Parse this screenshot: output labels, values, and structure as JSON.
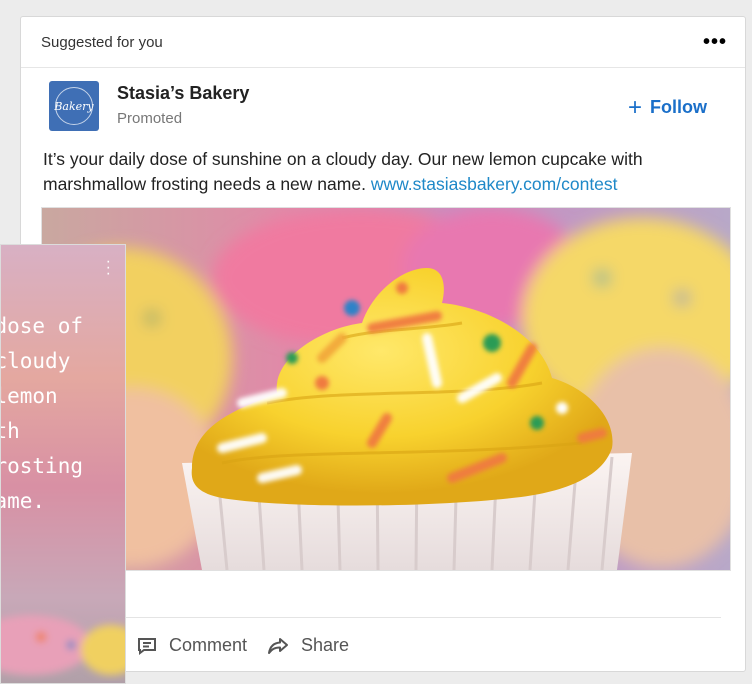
{
  "card": {
    "header_label": "Suggested for you",
    "more_label": "•••"
  },
  "author": {
    "name": "Stasia’s Bakery",
    "subtitle": "Promoted",
    "logo_text": "Bakery"
  },
  "follow": {
    "plus": "+",
    "label": "Follow"
  },
  "post": {
    "text": "It’s your daily dose of sunshine on a cloudy day. Our new lemon cupcake with marshmallow frosting needs a new name.",
    "link": "www.stasiasbakery.com/contest"
  },
  "actions": [
    {
      "label": "Comment",
      "icon": "comment-icon"
    },
    {
      "label": "Share",
      "icon": "share-icon"
    }
  ],
  "overlay": {
    "text": "dose of\ncloudy\nlemon\nth\nrosting\name.",
    "menu_icon": "vertical-dots-icon"
  },
  "colors": {
    "accent": "#1a6fc9",
    "link": "#1e88c8",
    "logo_bg": "#3f6fb5"
  }
}
